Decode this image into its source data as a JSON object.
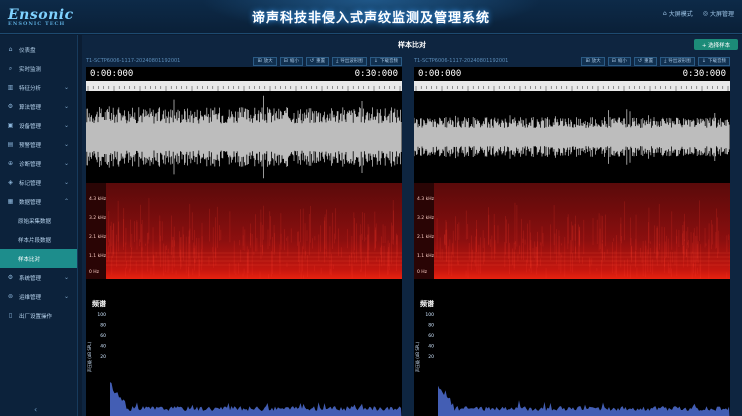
{
  "header": {
    "logo_text": "Ensonic",
    "logo_sub": "ENSONIC TECH",
    "title": "谛声科技非侵入式声纹监测及管理系统",
    "right_items": [
      {
        "icon": "home-icon",
        "label": "大屏模式"
      },
      {
        "icon": "user-icon",
        "label": "大屏管理"
      }
    ]
  },
  "sidebar": {
    "items": [
      {
        "icon": "home-icon",
        "label": "仪表盘",
        "has_chevron": false
      },
      {
        "icon": "search-icon",
        "label": "实时监测",
        "has_chevron": false
      },
      {
        "icon": "chart-icon",
        "label": "特征分析",
        "has_chevron": true
      },
      {
        "icon": "gear-icon",
        "label": "算法管理",
        "has_chevron": true
      },
      {
        "icon": "device-icon",
        "label": "设备管理",
        "has_chevron": true
      },
      {
        "icon": "alarm-icon",
        "label": "预警管理",
        "has_chevron": true
      },
      {
        "icon": "diagnosis-icon",
        "label": "诊断管理",
        "has_chevron": true
      },
      {
        "icon": "tag-icon",
        "label": "标记管理",
        "has_chevron": true
      },
      {
        "icon": "database-icon",
        "label": "数据管理",
        "has_chevron": true,
        "expanded": true
      }
    ],
    "sub_items": [
      {
        "label": "原始采集数据"
      },
      {
        "label": "样本片段数据"
      },
      {
        "label": "样本比对",
        "active": true
      }
    ],
    "items_after": [
      {
        "icon": "gear-icon",
        "label": "系统管理",
        "has_chevron": true
      },
      {
        "icon": "ops-icon",
        "label": "运维管理",
        "has_chevron": true
      },
      {
        "icon": "doc-icon",
        "label": "出厂设置操作",
        "has_chevron": false
      }
    ],
    "collapse_glyph": "‹"
  },
  "main": {
    "title": "样本比对",
    "select_button": "+ 选择样本",
    "toolbar": [
      "放大",
      "缩小",
      "重置",
      "导出波形图",
      "下载音频"
    ],
    "panels": [
      {
        "file": "T1-SCTP6006-1117-20240801192001",
        "time_start": "0:00:000",
        "time_end": "0:30:000"
      },
      {
        "file": "T1-SCTP6006-1117-20240801192001",
        "time_start": "0:00:000",
        "time_end": "0:30:000"
      }
    ],
    "spectro_labels": [
      "4.3 kHz",
      "3.2 kHz",
      "2.1 kHz",
      "1.1 kHz",
      "0 Hz"
    ],
    "freq_title": "频谱",
    "freq_axis_label": "声压级 (dB SPL)",
    "freq_ticks": [
      "100",
      "80",
      "60",
      "40",
      "20"
    ]
  },
  "colors": {
    "accent": "#1d8d8c",
    "button": "#1c8b78",
    "waveform": "#bdbdbd",
    "spectrum_fill": "#4a68c8"
  }
}
